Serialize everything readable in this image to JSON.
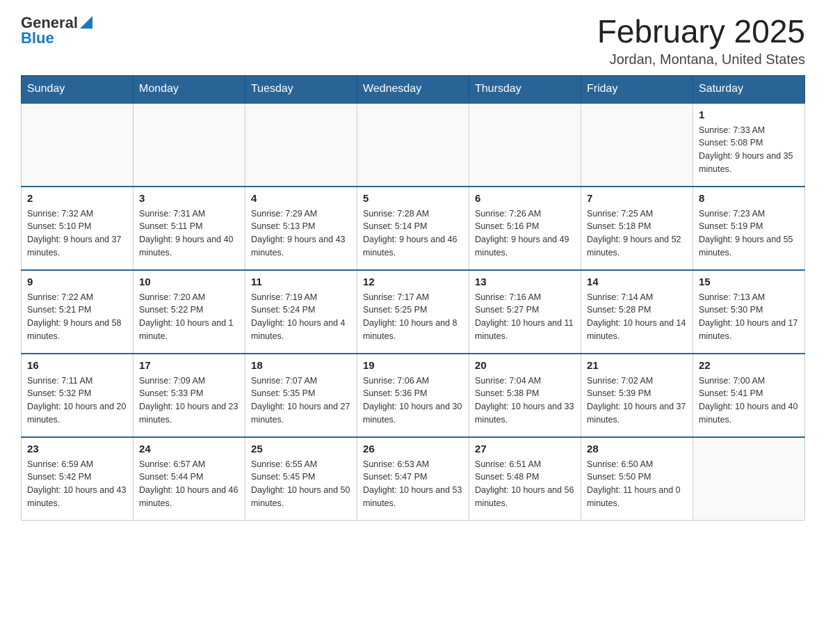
{
  "logo": {
    "text_general": "General",
    "text_blue": "Blue"
  },
  "header": {
    "month_year": "February 2025",
    "location": "Jordan, Montana, United States"
  },
  "days_of_week": [
    "Sunday",
    "Monday",
    "Tuesday",
    "Wednesday",
    "Thursday",
    "Friday",
    "Saturday"
  ],
  "weeks": [
    [
      {
        "day": "",
        "info": ""
      },
      {
        "day": "",
        "info": ""
      },
      {
        "day": "",
        "info": ""
      },
      {
        "day": "",
        "info": ""
      },
      {
        "day": "",
        "info": ""
      },
      {
        "day": "",
        "info": ""
      },
      {
        "day": "1",
        "info": "Sunrise: 7:33 AM\nSunset: 5:08 PM\nDaylight: 9 hours and 35 minutes."
      }
    ],
    [
      {
        "day": "2",
        "info": "Sunrise: 7:32 AM\nSunset: 5:10 PM\nDaylight: 9 hours and 37 minutes."
      },
      {
        "day": "3",
        "info": "Sunrise: 7:31 AM\nSunset: 5:11 PM\nDaylight: 9 hours and 40 minutes."
      },
      {
        "day": "4",
        "info": "Sunrise: 7:29 AM\nSunset: 5:13 PM\nDaylight: 9 hours and 43 minutes."
      },
      {
        "day": "5",
        "info": "Sunrise: 7:28 AM\nSunset: 5:14 PM\nDaylight: 9 hours and 46 minutes."
      },
      {
        "day": "6",
        "info": "Sunrise: 7:26 AM\nSunset: 5:16 PM\nDaylight: 9 hours and 49 minutes."
      },
      {
        "day": "7",
        "info": "Sunrise: 7:25 AM\nSunset: 5:18 PM\nDaylight: 9 hours and 52 minutes."
      },
      {
        "day": "8",
        "info": "Sunrise: 7:23 AM\nSunset: 5:19 PM\nDaylight: 9 hours and 55 minutes."
      }
    ],
    [
      {
        "day": "9",
        "info": "Sunrise: 7:22 AM\nSunset: 5:21 PM\nDaylight: 9 hours and 58 minutes."
      },
      {
        "day": "10",
        "info": "Sunrise: 7:20 AM\nSunset: 5:22 PM\nDaylight: 10 hours and 1 minute."
      },
      {
        "day": "11",
        "info": "Sunrise: 7:19 AM\nSunset: 5:24 PM\nDaylight: 10 hours and 4 minutes."
      },
      {
        "day": "12",
        "info": "Sunrise: 7:17 AM\nSunset: 5:25 PM\nDaylight: 10 hours and 8 minutes."
      },
      {
        "day": "13",
        "info": "Sunrise: 7:16 AM\nSunset: 5:27 PM\nDaylight: 10 hours and 11 minutes."
      },
      {
        "day": "14",
        "info": "Sunrise: 7:14 AM\nSunset: 5:28 PM\nDaylight: 10 hours and 14 minutes."
      },
      {
        "day": "15",
        "info": "Sunrise: 7:13 AM\nSunset: 5:30 PM\nDaylight: 10 hours and 17 minutes."
      }
    ],
    [
      {
        "day": "16",
        "info": "Sunrise: 7:11 AM\nSunset: 5:32 PM\nDaylight: 10 hours and 20 minutes."
      },
      {
        "day": "17",
        "info": "Sunrise: 7:09 AM\nSunset: 5:33 PM\nDaylight: 10 hours and 23 minutes."
      },
      {
        "day": "18",
        "info": "Sunrise: 7:07 AM\nSunset: 5:35 PM\nDaylight: 10 hours and 27 minutes."
      },
      {
        "day": "19",
        "info": "Sunrise: 7:06 AM\nSunset: 5:36 PM\nDaylight: 10 hours and 30 minutes."
      },
      {
        "day": "20",
        "info": "Sunrise: 7:04 AM\nSunset: 5:38 PM\nDaylight: 10 hours and 33 minutes."
      },
      {
        "day": "21",
        "info": "Sunrise: 7:02 AM\nSunset: 5:39 PM\nDaylight: 10 hours and 37 minutes."
      },
      {
        "day": "22",
        "info": "Sunrise: 7:00 AM\nSunset: 5:41 PM\nDaylight: 10 hours and 40 minutes."
      }
    ],
    [
      {
        "day": "23",
        "info": "Sunrise: 6:59 AM\nSunset: 5:42 PM\nDaylight: 10 hours and 43 minutes."
      },
      {
        "day": "24",
        "info": "Sunrise: 6:57 AM\nSunset: 5:44 PM\nDaylight: 10 hours and 46 minutes."
      },
      {
        "day": "25",
        "info": "Sunrise: 6:55 AM\nSunset: 5:45 PM\nDaylight: 10 hours and 50 minutes."
      },
      {
        "day": "26",
        "info": "Sunrise: 6:53 AM\nSunset: 5:47 PM\nDaylight: 10 hours and 53 minutes."
      },
      {
        "day": "27",
        "info": "Sunrise: 6:51 AM\nSunset: 5:48 PM\nDaylight: 10 hours and 56 minutes."
      },
      {
        "day": "28",
        "info": "Sunrise: 6:50 AM\nSunset: 5:50 PM\nDaylight: 11 hours and 0 minutes."
      },
      {
        "day": "",
        "info": ""
      }
    ]
  ]
}
